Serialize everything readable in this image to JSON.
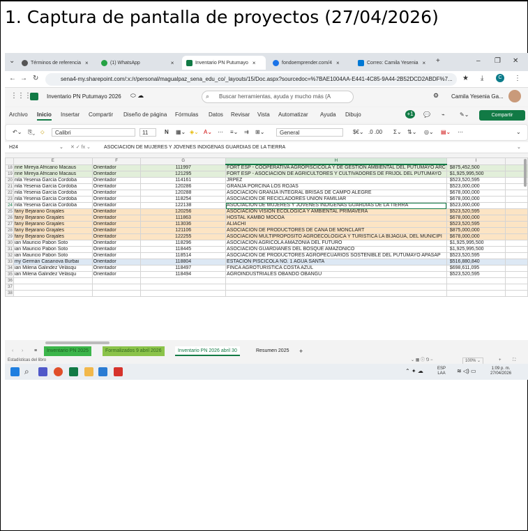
{
  "heading": "1. Captura de pantalla de proyectos (27/04/2026)",
  "browser": {
    "tabs": [
      {
        "label": "Términos de referencia",
        "color": "#555"
      },
      {
        "label": "(1) WhatsApp",
        "color": "#25a244"
      },
      {
        "label": "Inventario PN Putumayo",
        "color": "#117a45"
      },
      {
        "label": "fondoemprender.com/4",
        "color": "#1a73e8"
      },
      {
        "label": "Correo: Camila Yesenia",
        "color": "#0078d4"
      }
    ],
    "new_tab": "+",
    "url": "sena4-my.sharepoint.com/:x:/r/personal/magualpaz_sena_edu_co/_layouts/15/Doc.aspx?sourcedoc=%7BAE1004AA-E441-4C85-9A44-2B52DCD2ABDF%7..."
  },
  "app": {
    "doc_title": "Inventario PN Putumayo 2026",
    "search_placeholder": "Buscar herramientas, ayuda y mucho más (A",
    "user": "Camila Yesenia Ga...",
    "menus": [
      "Archivo",
      "Inicio",
      "Insertar",
      "Compartir",
      "Diseño de página",
      "Fórmulas",
      "Datos",
      "Revisar",
      "Vista",
      "Automatizar",
      "Ayuda",
      "Dibujo"
    ],
    "share_label": "Compartir",
    "font": "Calibri",
    "font_size": "11",
    "number_format": "General",
    "cell_ref": "H24",
    "formula_value": "ASOCIACION DE MUJERES Y JOVENES INDIGENAS GUARDIAS DE LA TIERRA"
  },
  "grid": {
    "columns": [
      "E",
      "F",
      "G",
      "H",
      "I"
    ],
    "rows": [
      {
        "n": "18",
        "e": "nne Mireya Africano Macaus",
        "f": "Orientador",
        "g": "111997",
        "h": "FORT ESP - COOPERATIVA AGROPISCICOLA Y DE GESTION AMBIENTAL DEL PUTUMAYO ARC",
        "i": "$875,452,500",
        "c": "g"
      },
      {
        "n": "19",
        "e": "nne Mireya Africano Macaus",
        "f": "Orientador",
        "g": "121295",
        "h": "FORT ESP - ASOCIACIÓN DE AGRICULTORES Y CULTIVADORES DE FRIJOL DEL PUTUMAYO",
        "i": "$1,925,995,500",
        "c": "g"
      },
      {
        "n": "20",
        "e": "nila Yesenia García Cordoba",
        "f": "Orientador",
        "g": "114161",
        "h": "JRPEZ",
        "i": "$523,520,595",
        "c": ""
      },
      {
        "n": "21",
        "e": "nila Yesenia García Cordoba",
        "f": "Orientador",
        "g": "120286",
        "h": "GRANJA PORCINA LOS ROJAS",
        "i": "$523,000,000",
        "c": ""
      },
      {
        "n": "22",
        "e": "nila Yesenia García Cordoba",
        "f": "Orientador",
        "g": "120288",
        "h": "ASOCIACION GRANJA INTEGRAL BRISAS DE CAMPO ALEGRE",
        "i": "$678,000,000",
        "c": ""
      },
      {
        "n": "23",
        "e": "nila Yesenia García Cordoba",
        "f": "Orientador",
        "g": "118254",
        "h": "ASOCIACION DE RECICLADORES UNION FAMILIAR",
        "i": "$678,000,000",
        "c": ""
      },
      {
        "n": "24",
        "e": "nila Yesenia García Cordoba",
        "f": "Orientador",
        "g": "122138",
        "h": "ASOCIACION DE MUJERES Y JOVENES INDIGENAS GUARDIAS DE LA TIERRA",
        "i": "$523,000,000",
        "c": "",
        "sel": true
      },
      {
        "n": "25",
        "e": "fany Bejarano Grajales",
        "f": "Orientador",
        "g": "120256",
        "h": "ASOCIACIÓN VISIÓN ECOLÓGICA Y AMBIENTAL PRIMAVERA",
        "i": "$523,520,595",
        "c": "o"
      },
      {
        "n": "26",
        "e": "fany Bejarano Grajales",
        "f": "Orientador",
        "g": "111863",
        "h": "HOSTAL KAMBO MOCOA",
        "i": "$678,000,000",
        "c": "o"
      },
      {
        "n": "27",
        "e": "fany Bejarano Grajales",
        "f": "Orientador",
        "g": "113036",
        "h": "ALIACHI",
        "i": "$523,520,595",
        "c": "o"
      },
      {
        "n": "28",
        "e": "fany Bejarano Grajales",
        "f": "Orientador",
        "g": "121106",
        "h": "ASOCIACION DE PRODUCTORES DE CAÑA DE MONCLART",
        "i": "$875,000,000",
        "c": "o"
      },
      {
        "n": "29",
        "e": "fany Bejarano Grajales",
        "f": "Orientador",
        "g": "122255",
        "h": "ASOCIACIÓN MULTIPROPOSITO AGROECOLOGICA Y TURÍSTICA LA BIJAGUA, DEL MUNICIPI",
        "i": "$678,000,000",
        "c": "o"
      },
      {
        "n": "30",
        "e": "ian Mauricio Pabon Soto",
        "f": "Orientador",
        "g": "118296",
        "h": "ASOCIACION AGRICOLA AMAZONIA DEL FUTURO",
        "i": "$1,925,995,500",
        "c": ""
      },
      {
        "n": "31",
        "e": "ian Mauricio Pabon Soto",
        "f": "Orientador",
        "g": "118445",
        "h": "ASOCIACION GUARDIANES DEL BOSQUE AMAZONICO",
        "i": "$1,925,995,500",
        "c": ""
      },
      {
        "n": "32",
        "e": "ian Mauricio Pabon Soto",
        "f": "Orientador",
        "g": "118514",
        "h": "ASOCIACION DE PRODUCTORES AGROPECUARIOS SOSTENIBLE DEL PUTUMAYO APASAP",
        "i": "$523,520,595",
        "c": ""
      },
      {
        "n": "33",
        "e": "my Germán Casanova Burbai",
        "f": "Orientador",
        "g": "118804",
        "h": "ESTACION PISCÍCOLA NO. 1 AGUA SANTA",
        "i": "$516,880,840",
        "c": "b"
      },
      {
        "n": "34",
        "e": "ian Milena Galindez Velásqu",
        "f": "Orientador",
        "g": "118497",
        "h": "FINCA AGROTURÍSTICA COSTA AZUL",
        "i": "$698,611,095",
        "c": ""
      },
      {
        "n": "35",
        "e": "ian Milena Galindez Velásqu",
        "f": "Orientador",
        "g": "118494",
        "h": "AGROINDUSTRIALES OBANDO OBANGU",
        "i": "$523,520,595",
        "c": ""
      },
      {
        "n": "36",
        "e": "",
        "f": "",
        "g": "",
        "h": "",
        "i": "",
        "c": ""
      },
      {
        "n": "37",
        "e": "",
        "f": "",
        "g": "",
        "h": "",
        "i": "",
        "c": ""
      },
      {
        "n": "38",
        "e": "",
        "f": "",
        "g": "",
        "h": "",
        "i": "",
        "c": ""
      }
    ]
  },
  "sheet_tabs": [
    {
      "label": "Inventario PN 2025",
      "bg": "#3cb54a",
      "fg": "#1b5e20"
    },
    {
      "label": "Formalizados 9 abril 2026",
      "bg": "#8bc34a",
      "fg": "#33691e"
    },
    {
      "label": "Inventario PN 2026 abril 30",
      "bg": "#ffffff",
      "fg": "#117a45"
    },
    {
      "label": "Resumen 2025",
      "bg": "#f3f3f3",
      "fg": "#333"
    }
  ],
  "status": {
    "left": "Estadísticas del libro",
    "zoom": "100%"
  },
  "taskbar": {
    "lang1": "ESP",
    "lang2": "LAA",
    "time": "1:09 p. m.",
    "date": "27/04/2026"
  }
}
